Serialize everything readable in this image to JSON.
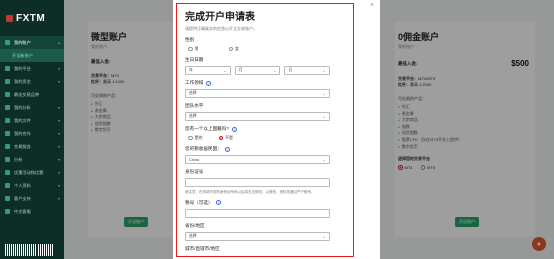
{
  "brand": {
    "name": "FXTM"
  },
  "sidebar": {
    "items": [
      {
        "label": "我的账户"
      },
      {
        "label": "开设新账户"
      },
      {
        "label": "我的平台"
      },
      {
        "label": "我的资金"
      },
      {
        "label": "最佳交易品种"
      },
      {
        "label": "我的分析"
      },
      {
        "label": "我的文件"
      },
      {
        "label": "我的合作"
      },
      {
        "label": "交易服务"
      },
      {
        "label": "分析"
      },
      {
        "label": "优惠活动和比赛"
      },
      {
        "label": "个人资料"
      },
      {
        "label": "客户支持"
      },
      {
        "label": "中文客服"
      }
    ]
  },
  "left_card": {
    "title": "微型账户",
    "subtitle": "我的账户",
    "min_deposit_label": "最低入金:",
    "platform_label": "交易平台：",
    "platform_value": "MT4",
    "leverage_label": "杠杆：",
    "leverage_value": "最高 1:1000",
    "features_label": "可交易的产品：",
    "features": [
      "外汇",
      "贵金属",
      "大宗商品",
      "现货指数",
      "数字货币"
    ],
    "open_button": "开设账户"
  },
  "right_card": {
    "title": "0佣金账户",
    "subtitle": "我的账户",
    "min_deposit_label": "最低入金:",
    "min_deposit_value": "$500",
    "platform_label": "交易平台：",
    "platform_value": "MT4/MT5",
    "leverage_label": "杠杆：",
    "leverage_value": "最高 1:2000",
    "features_label": "可交易的产品：",
    "features": [
      "外汇",
      "贵金属",
      "大宗商品",
      "指数",
      "现货指数",
      "股票CFD（仅在MT5平台上提供）",
      "数字货币"
    ],
    "choose_label": "选择您的交易平台",
    "radio_options": [
      "MT4",
      "MT5"
    ],
    "open_button": "开设账户"
  },
  "modal": {
    "title": "完成开户申请表",
    "subtitle": "请提供正确真实的信息以开立交易账户。",
    "gender_label": "性别",
    "gender_options": [
      "男",
      "女"
    ],
    "birthday_label": "生日日期",
    "birthday_year": "年",
    "birthday_month": "月",
    "birthday_day": "日",
    "employment_label": "工作领域",
    "employment_value": "选择",
    "education_label": "团队水平",
    "education_value": "选择",
    "us_tax_label": "您有一个以上国籍吗?",
    "us_tax_options": [
      "是的",
      "不是"
    ],
    "tax_country_label": "您的税收居民国：",
    "tax_country_value": "China",
    "id_label": "身份证号",
    "id_help": "请注意，在您填写您的身份证号码以后将无法修改，以便资，资料您通过严户账号。",
    "tax_id_label": "税号（可选）",
    "province_label": "省份/地区",
    "province_value": "选择",
    "city_label": "城市/直辖市/地区"
  }
}
